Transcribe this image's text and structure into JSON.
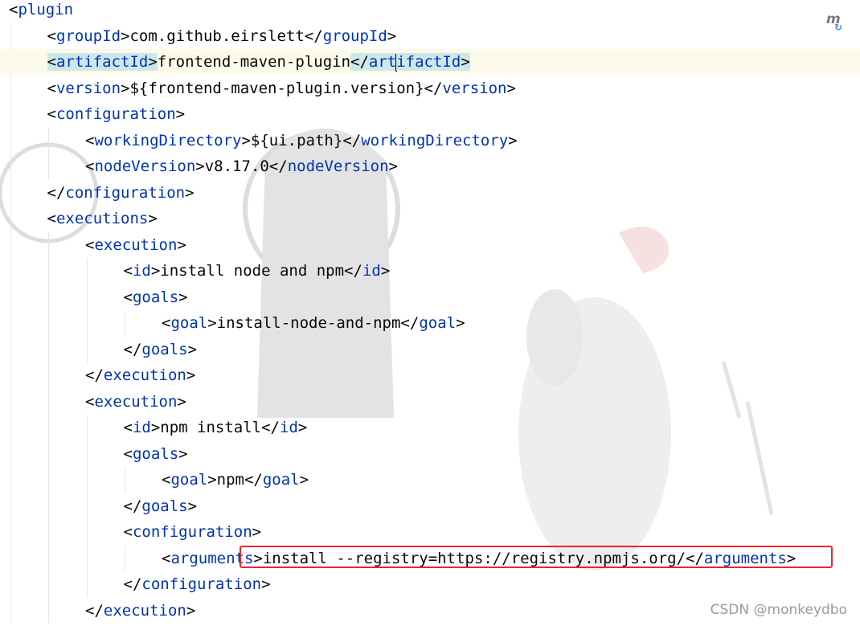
{
  "editor": {
    "lines": [
      [
        {
          "t": "<",
          "c": "br"
        },
        {
          "t": "plugin",
          "c": "tag"
        }
      ],
      [
        {
          "t": "<",
          "c": "br"
        },
        {
          "t": "groupId",
          "c": "tag"
        },
        {
          "t": ">com.github.eirslett</",
          "c": "br"
        },
        {
          "t": "groupId",
          "c": "tag"
        },
        {
          "t": ">",
          "c": "br"
        }
      ],
      [
        {
          "t": "<",
          "c": "br match"
        },
        {
          "t": "artifactId",
          "c": "tag match"
        },
        {
          "t": ">",
          "c": "br match"
        },
        {
          "t": "frontend-maven-plugin",
          "c": "br"
        },
        {
          "t": "</",
          "c": "br match"
        },
        {
          "t": "art",
          "c": "tag match"
        },
        {
          "caret": true
        },
        {
          "t": "ifactId",
          "c": "tag match"
        },
        {
          "t": ">",
          "c": "br match"
        }
      ],
      [
        {
          "t": "<",
          "c": "br"
        },
        {
          "t": "version",
          "c": "tag"
        },
        {
          "t": ">${frontend-maven-plugin.version}</",
          "c": "br"
        },
        {
          "t": "version",
          "c": "tag"
        },
        {
          "t": ">",
          "c": "br"
        }
      ],
      [
        {
          "t": "<",
          "c": "br"
        },
        {
          "t": "configuration",
          "c": "tag"
        },
        {
          "t": ">",
          "c": "br"
        }
      ],
      [
        {
          "t": "<",
          "c": "br"
        },
        {
          "t": "workingDirectory",
          "c": "tag"
        },
        {
          "t": ">${ui.path}</",
          "c": "br"
        },
        {
          "t": "workingDirectory",
          "c": "tag"
        },
        {
          "t": ">",
          "c": "br"
        }
      ],
      [
        {
          "t": "<",
          "c": "br"
        },
        {
          "t": "nodeVersion",
          "c": "tag"
        },
        {
          "t": ">v8.17.0</",
          "c": "br"
        },
        {
          "t": "nodeVersion",
          "c": "tag"
        },
        {
          "t": ">",
          "c": "br"
        }
      ],
      [
        {
          "t": "</",
          "c": "br"
        },
        {
          "t": "configuration",
          "c": "tag"
        },
        {
          "t": ">",
          "c": "br"
        }
      ],
      [
        {
          "t": "<",
          "c": "br"
        },
        {
          "t": "executions",
          "c": "tag"
        },
        {
          "t": ">",
          "c": "br"
        }
      ],
      [
        {
          "t": "<",
          "c": "br"
        },
        {
          "t": "execution",
          "c": "tag"
        },
        {
          "t": ">",
          "c": "br"
        }
      ],
      [
        {
          "t": "<",
          "c": "br"
        },
        {
          "t": "id",
          "c": "tag"
        },
        {
          "t": ">install node and npm</",
          "c": "br"
        },
        {
          "t": "id",
          "c": "tag"
        },
        {
          "t": ">",
          "c": "br"
        }
      ],
      [
        {
          "t": "<",
          "c": "br"
        },
        {
          "t": "goals",
          "c": "tag"
        },
        {
          "t": ">",
          "c": "br"
        }
      ],
      [
        {
          "t": "<",
          "c": "br"
        },
        {
          "t": "goal",
          "c": "tag"
        },
        {
          "t": ">install-node-and-npm</",
          "c": "br"
        },
        {
          "t": "goal",
          "c": "tag"
        },
        {
          "t": ">",
          "c": "br"
        }
      ],
      [
        {
          "t": "</",
          "c": "br"
        },
        {
          "t": "goals",
          "c": "tag"
        },
        {
          "t": ">",
          "c": "br"
        }
      ],
      [
        {
          "t": "</",
          "c": "br"
        },
        {
          "t": "execution",
          "c": "tag"
        },
        {
          "t": ">",
          "c": "br"
        }
      ],
      [
        {
          "t": "<",
          "c": "br"
        },
        {
          "t": "execution",
          "c": "tag"
        },
        {
          "t": ">",
          "c": "br"
        }
      ],
      [
        {
          "t": "<",
          "c": "br"
        },
        {
          "t": "id",
          "c": "tag"
        },
        {
          "t": ">npm install</",
          "c": "br"
        },
        {
          "t": "id",
          "c": "tag"
        },
        {
          "t": ">",
          "c": "br"
        }
      ],
      [
        {
          "t": "<",
          "c": "br"
        },
        {
          "t": "goals",
          "c": "tag"
        },
        {
          "t": ">",
          "c": "br"
        }
      ],
      [
        {
          "t": "<",
          "c": "br"
        },
        {
          "t": "goal",
          "c": "tag"
        },
        {
          "t": ">npm</",
          "c": "br"
        },
        {
          "t": "goal",
          "c": "tag"
        },
        {
          "t": ">",
          "c": "br"
        }
      ],
      [
        {
          "t": "</",
          "c": "br"
        },
        {
          "t": "goals",
          "c": "tag"
        },
        {
          "t": ">",
          "c": "br"
        }
      ],
      [
        {
          "t": "<",
          "c": "br"
        },
        {
          "t": "configuration",
          "c": "tag"
        },
        {
          "t": ">",
          "c": "br"
        }
      ],
      [
        {
          "t": "<",
          "c": "br"
        },
        {
          "t": "arguments",
          "c": "tag"
        },
        {
          "t": ">install --registry=https://registry.npmjs.org/</",
          "c": "br"
        },
        {
          "t": "arguments",
          "c": "tag"
        },
        {
          "t": ">",
          "c": "br"
        }
      ],
      [
        {
          "t": "</",
          "c": "br"
        },
        {
          "t": "configuration",
          "c": "tag"
        },
        {
          "t": ">",
          "c": "br"
        }
      ],
      [
        {
          "t": "</",
          "c": "br"
        },
        {
          "t": "execution",
          "c": "tag"
        },
        {
          "t": ">",
          "c": "br"
        }
      ]
    ],
    "current_line": 2,
    "highlighted_line": 21
  },
  "gutter_icon": {
    "icon": "maven-reload-icon",
    "glyph": "m",
    "sync_glyph": "↻"
  },
  "credit": "CSDN @monkeydbo",
  "colors": {
    "tag": "#0033b3",
    "text": "#080808",
    "highlight_box": "#f0242a",
    "current_line_bg": "#fcfae9",
    "match_bg": "#cde8ea"
  }
}
